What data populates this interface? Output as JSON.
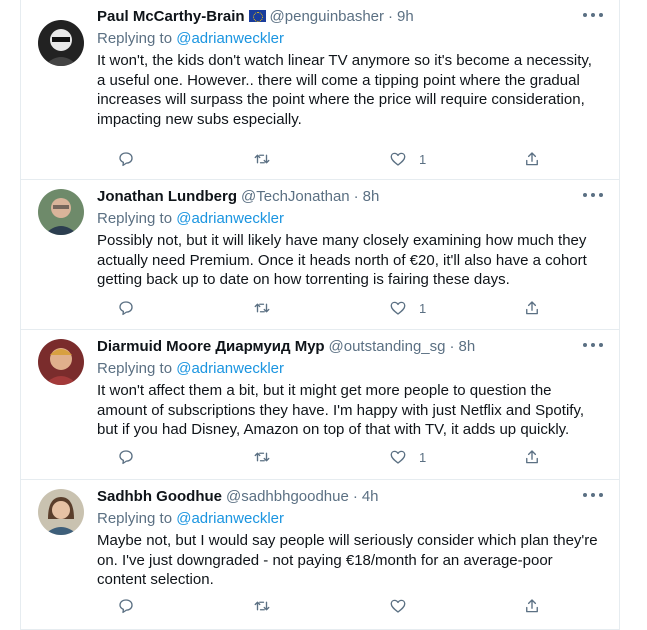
{
  "colors": {
    "link": "#1b95e0",
    "muted": "#5b7083",
    "text": "#0f1419",
    "border": "#e6ecf0"
  },
  "icons": [
    "reply-icon",
    "retweet-icon",
    "like-icon",
    "share-icon",
    "more-icon",
    "eu-flag-icon"
  ],
  "tweets": [
    {
      "name": "Paul McCarthy-Brain",
      "handle": "@penguinbasher",
      "separator": "·",
      "time": "9h",
      "replying_prefix": "Replying to",
      "replying_to": "@adrianweckler",
      "text": "It won't, the kids don't watch linear TV anymore so it's become a necessity, a useful one. However.. there will come a tipping point where the gradual increases will surpass the point where the price will require consideration, impacting new subs especially.",
      "likes": "1"
    },
    {
      "name": "Jonathan Lundberg",
      "handle": "@TechJonathan",
      "separator": "·",
      "time": "8h",
      "replying_prefix": "Replying to",
      "replying_to": "@adrianweckler",
      "text": "Possibly not, but it will likely have many closely examining how much they actually need Premium.  Once it heads north of €20, it'll also have a cohort getting back up to date on how torrenting is fairing these days.",
      "likes": "1"
    },
    {
      "name": "Diarmuid Moore Диармуид Мур",
      "handle": "@outstanding_sg",
      "separator": "·",
      "time": "8h",
      "replying_prefix": "Replying to",
      "replying_to": "@adrianweckler",
      "text": "It won't affect them a bit, but it might get more people to question the amount of subscriptions they have. I'm happy with just Netflix and Spotify, but if you had Disney, Amazon on top of that with TV, it adds up quickly.",
      "likes": "1"
    },
    {
      "name": "Sadhbh Goodhue",
      "handle": "@sadhbhgoodhue",
      "separator": "·",
      "time": "4h",
      "replying_prefix": "Replying to",
      "replying_to": "@adrianweckler",
      "text": "Maybe not, but I would say people will seriously consider which plan they're on. I've just downgraded - not paying €18/month for an average-poor content selection.",
      "likes": ""
    }
  ]
}
